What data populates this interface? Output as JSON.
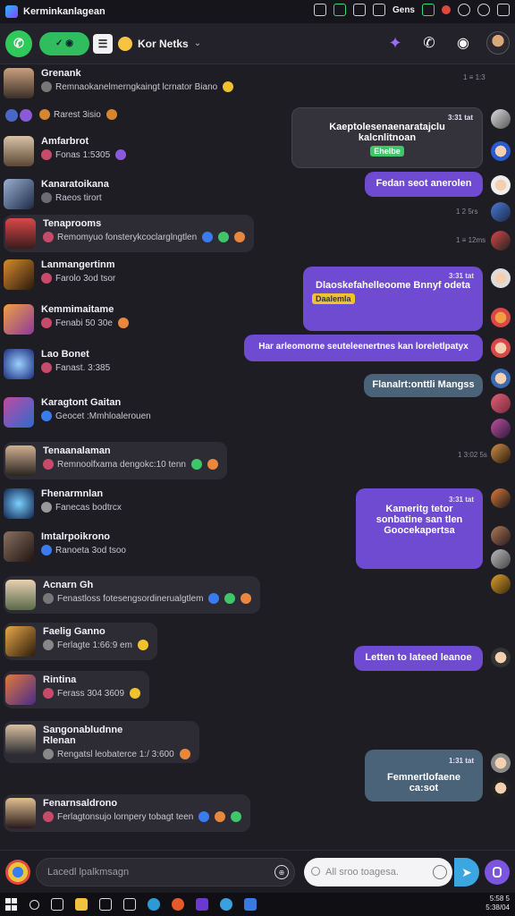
{
  "window": {
    "title": "Kerminkanlagean"
  },
  "tray": {
    "label": "Gens"
  },
  "header": {
    "status_label": "✓ ◉",
    "menu_label": "☰",
    "chat_name": "Kor Netks",
    "chevron": "⌄"
  },
  "left_messages": [
    {
      "name": "Grenank",
      "preview": "Remnaokanelmerngkaingt lcrnator Biano",
      "time": "1 ≡ 1:3"
    },
    {
      "name": "",
      "preview": "Rarest 3isio",
      "time": ""
    },
    {
      "name": "Amfarbrot",
      "preview": "Fonas 1:5305",
      "time": ""
    },
    {
      "name": "Kanaratoikana",
      "preview": "Raeos tirort",
      "time": "1 2 5rs"
    },
    {
      "name": "Tenaprooms",
      "preview": "Remomyuo fonsterykcoclarglngtlen",
      "time": "1 ≡ 12ms"
    },
    {
      "name": "Lanmangertinm",
      "preview": "Farolo 3od tsor",
      "time": ""
    },
    {
      "name": "Kemmimaitame",
      "preview": "Fenabi 50 30e",
      "time": ""
    },
    {
      "name": "Lao Bonet",
      "preview": "Fanast. 3:385",
      "time": ""
    },
    {
      "name": "Karagtont Gaitan",
      "preview": "Geocet :Mmhloalerouen",
      "time": ""
    },
    {
      "name": "Tenaanalaman",
      "preview": "Remnoolfxama dengokc:10 tenn",
      "time": "1 3:02 5s"
    },
    {
      "name": "Fhenarmnlan",
      "preview": "Fanecas bodtrcx",
      "time": ""
    },
    {
      "name": "Imtalrpoikrono",
      "preview": "Ranoeta 3od tsoo",
      "time": ""
    },
    {
      "name": "Acnarn Gh",
      "preview": "Fenastloss fotesengsordinerualgtlem",
      "time": ""
    },
    {
      "name": "Faelig Ganno",
      "preview": "Ferlagte 1:66:9 em",
      "time": ""
    },
    {
      "name": "Rintina",
      "preview": "Ferass 304 3609",
      "time": ""
    },
    {
      "name": "Sangonabludnne",
      "sub": "Rlenan",
      "preview": "Rengatsl leobaterce 1:/ 3:600",
      "time": ""
    },
    {
      "name": "Fenarnsaldrono",
      "preview": "Ferlagtonsujo lornpery tobagt teen",
      "time": ""
    }
  ],
  "right_messages": [
    {
      "time": "3:31 tat",
      "text": "Kaeptolesenaenaratajclu kalcnlitnoan",
      "chip": "Ehelbe"
    },
    {
      "time": "",
      "text": "Fedan seot anerolen"
    },
    {
      "time": "3:31 tat",
      "text": "Dlaoskefahelleoome Bnnyf odeta",
      "chip": "Daalemla"
    },
    {
      "time": "",
      "text": "Har arleomorne seuteleenertnes kan loreletlpatyx"
    },
    {
      "time": "",
      "text": "Flanalrt:onttli Mangss"
    },
    {
      "time": "3:31 tat",
      "text": "Kameritg tetor sonbatine san tlen Goocekapertsa"
    },
    {
      "time": "",
      "text": "Letten to lateed leanoe"
    },
    {
      "time": "1:31 tat",
      "text": "Femnertlofaene ca:sot"
    }
  ],
  "composer": {
    "input_placeholder": "Lacedl lpalkmsagn",
    "search_placeholder": "All sroo toagesa.",
    "send_label": "➤",
    "attach_label": "⊕"
  },
  "taskbar": {
    "clock_time": "5:58 5",
    "clock_date": "5:38/04"
  },
  "colors": {
    "accent_purple": "#6f4bd1",
    "accent_green": "#2fbd5e",
    "accent_blue": "#3aa7e0"
  }
}
